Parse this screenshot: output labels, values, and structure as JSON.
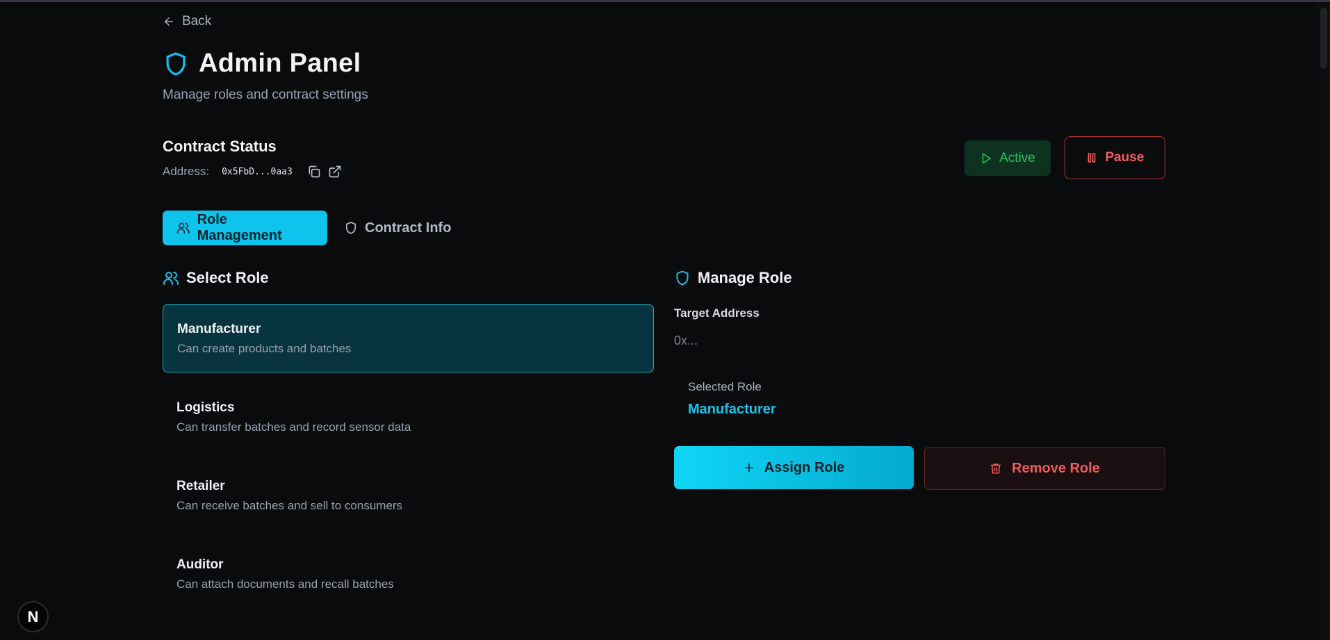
{
  "header": {
    "back_label": "Back",
    "title": "Admin Panel",
    "subtitle": "Manage roles and contract settings"
  },
  "contract": {
    "section_title": "Contract Status",
    "address_label": "Address:",
    "address_value": "0x5FbD...0aa3",
    "active_label": "Active",
    "pause_label": "Pause"
  },
  "tabs": [
    {
      "label": "Role Management",
      "icon": "users-icon",
      "active": true
    },
    {
      "label": "Contract Info",
      "icon": "shield-icon",
      "active": false
    }
  ],
  "select_role": {
    "heading": "Select Role",
    "roles": [
      {
        "name": "Manufacturer",
        "description": "Can create products and batches",
        "selected": true
      },
      {
        "name": "Logistics",
        "description": "Can transfer batches and record sensor data",
        "selected": false
      },
      {
        "name": "Retailer",
        "description": "Can receive batches and sell to consumers",
        "selected": false
      },
      {
        "name": "Auditor",
        "description": "Can attach documents and recall batches",
        "selected": false
      }
    ]
  },
  "manage_role": {
    "heading": "Manage Role",
    "target_label": "Target Address",
    "target_value": "",
    "target_placeholder": "0x...",
    "selected_label": "Selected Role",
    "selected_value": "Manufacturer",
    "assign_label": "Assign Role",
    "remove_label": "Remove Role"
  },
  "badge": {
    "label": "N"
  },
  "colors": {
    "background": "#0a0b0d",
    "accent": "#0ec3ec",
    "success": "#22c55e",
    "danger": "#ef5c5c"
  }
}
